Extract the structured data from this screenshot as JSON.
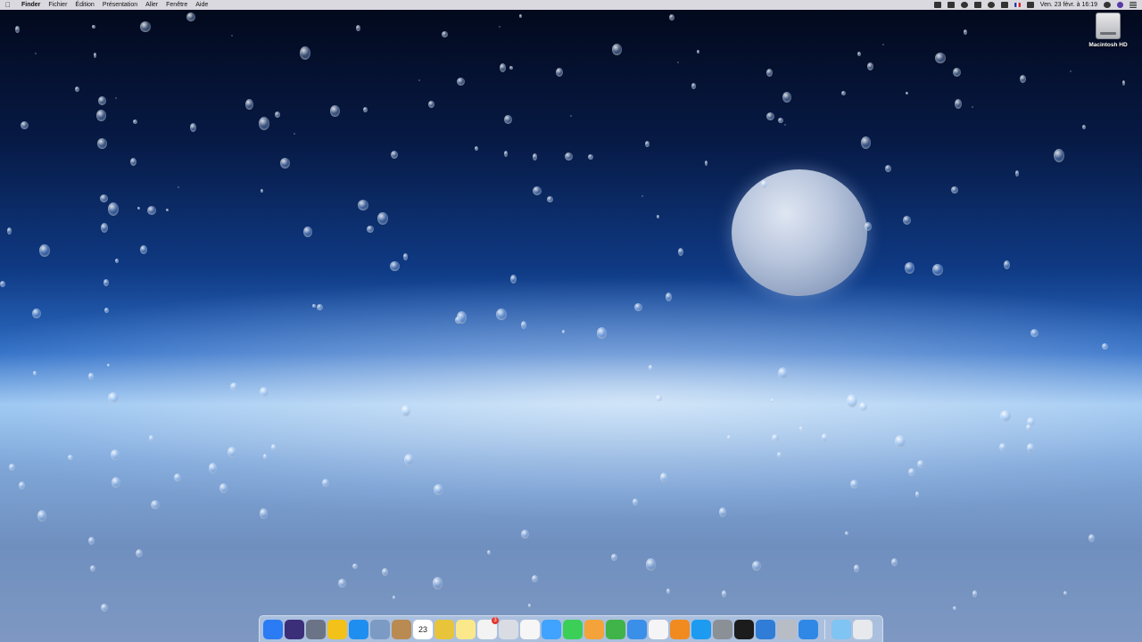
{
  "menubar": {
    "apple_icon": "apple-icon",
    "app_name": "Finder",
    "menus": [
      "Fichier",
      "Édition",
      "Présentation",
      "Aller",
      "Fenêtre",
      "Aide"
    ],
    "status_icons": [
      "dropbox-icon",
      "airplay-icon",
      "timemachine-icon",
      "bluetooth-icon",
      "wifi-icon",
      "volume-icon",
      "input-source-flag-fr-icon",
      "battery-icon"
    ],
    "clock": "Ven. 23 févr. à 16:19",
    "right_icons": [
      "search-icon",
      "user-avatar-icon",
      "notification-center-icon"
    ]
  },
  "desktop": {
    "icons": [
      {
        "label": "Macintosh HD",
        "icon": "hard-drive-icon"
      }
    ]
  },
  "dock": {
    "apps": [
      {
        "name": "finder",
        "icon": "finder-icon",
        "color": "#2a7bf4"
      },
      {
        "name": "siri",
        "icon": "siri-icon",
        "color": "#3b2f7a"
      },
      {
        "name": "launchpad",
        "icon": "launchpad-icon",
        "color": "#6a7486"
      },
      {
        "name": "cyberduck",
        "icon": "duck-icon",
        "color": "#f2c21a"
      },
      {
        "name": "safari",
        "icon": "safari-compass-icon",
        "color": "#1f8ef1"
      },
      {
        "name": "mail",
        "icon": "mail-stamp-icon",
        "color": "#7c9bc4"
      },
      {
        "name": "contacts",
        "icon": "contacts-book-icon",
        "color": "#b98a52"
      },
      {
        "name": "calendar",
        "icon": "calendar-icon",
        "color": "#ffffff",
        "text": "23"
      },
      {
        "name": "app-store-extra",
        "icon": "yellow-app-icon",
        "color": "#e8c43a"
      },
      {
        "name": "notes",
        "icon": "notes-icon",
        "color": "#fbe88a"
      },
      {
        "name": "reminders",
        "icon": "reminders-icon",
        "color": "#f3f3f3",
        "badge": "3"
      },
      {
        "name": "preview",
        "icon": "preview-icon",
        "color": "#d9dde3"
      },
      {
        "name": "photos",
        "icon": "photos-icon",
        "color": "#f6f6f6"
      },
      {
        "name": "messages",
        "icon": "messages-icon",
        "color": "#3fa3ff"
      },
      {
        "name": "facetime",
        "icon": "facetime-icon",
        "color": "#3bcf58"
      },
      {
        "name": "pages",
        "icon": "pages-icon",
        "color": "#f4a23a"
      },
      {
        "name": "numbers",
        "icon": "numbers-icon",
        "color": "#40b449"
      },
      {
        "name": "keynote",
        "icon": "keynote-icon",
        "color": "#3a8fe8"
      },
      {
        "name": "itunes",
        "icon": "itunes-icon",
        "color": "#f5f5f7"
      },
      {
        "name": "ibooks",
        "icon": "ibooks-icon",
        "color": "#f18a1f"
      },
      {
        "name": "app-store",
        "icon": "app-store-icon",
        "color": "#1d9bf0"
      },
      {
        "name": "system-preferences",
        "icon": "gear-icon",
        "color": "#8b8f96"
      },
      {
        "name": "terminal",
        "icon": "terminal-icon",
        "color": "#1c1c1c"
      },
      {
        "name": "xcode",
        "icon": "xcode-icon",
        "color": "#2f7dd6"
      },
      {
        "name": "utility",
        "icon": "scope-icon",
        "color": "#b8bcc4"
      },
      {
        "name": "migration",
        "icon": "blue-app-icon",
        "color": "#2f88e6"
      }
    ],
    "folders": [
      {
        "name": "downloads",
        "icon": "folder-icon",
        "color": "#7fc4f2"
      },
      {
        "name": "trash",
        "icon": "trash-icon",
        "color": "#e7e9ec"
      }
    ]
  }
}
